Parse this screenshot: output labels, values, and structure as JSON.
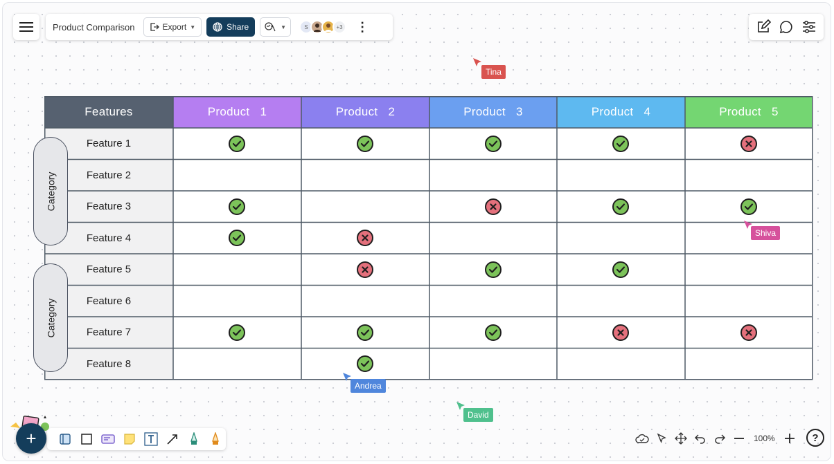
{
  "app": {
    "doc_title": "Product Comparison",
    "export_label": "Export",
    "share_label": "Share",
    "avatars": [
      {
        "initial": "S",
        "bg": "#e3e8f5"
      },
      {
        "initial": "",
        "bg": "#c9a88d"
      },
      {
        "initial": "",
        "bg": "#e6b34a"
      },
      {
        "initial": "+3",
        "bg": "#eef0f3"
      }
    ],
    "zoom_label": "100%",
    "help_label": "?"
  },
  "table": {
    "header_features": "Features",
    "products": [
      {
        "label": "Product   1",
        "color": "#b57ef1"
      },
      {
        "label": "Product   2",
        "color": "#8b80ef"
      },
      {
        "label": "Product   3",
        "color": "#6b9ff0"
      },
      {
        "label": "Product   4",
        "color": "#5eb9f0"
      },
      {
        "label": "Product   5",
        "color": "#74d672"
      }
    ],
    "features_header_color": "#566170",
    "grid_color": "#4f5a66",
    "features": [
      "Feature 1",
      "Feature 2",
      "Feature 3",
      "Feature 4",
      "Feature 5",
      "Feature 6",
      "Feature 7",
      "Feature 8"
    ],
    "categories": [
      {
        "label": "Category",
        "rows": [
          1,
          4
        ]
      },
      {
        "label": "Category",
        "rows": [
          5,
          8
        ]
      }
    ],
    "marks": [
      [
        "check",
        "check",
        "check",
        "check",
        "cross"
      ],
      [
        "",
        "",
        "",
        "",
        ""
      ],
      [
        "check",
        "",
        "cross",
        "check",
        "check"
      ],
      [
        "check",
        "cross",
        "",
        "",
        ""
      ],
      [
        "",
        "cross",
        "check",
        "check",
        ""
      ],
      [
        "",
        "",
        "",
        "",
        ""
      ],
      [
        "check",
        "check",
        "check",
        "cross",
        "cross"
      ],
      [
        "",
        "check",
        "",
        "",
        ""
      ]
    ]
  },
  "cursors": [
    {
      "name": "Tina",
      "color": "#d9534f"
    },
    {
      "name": "Shiva",
      "color": "#d6519c"
    },
    {
      "name": "Andrea",
      "color": "#4f86dc"
    },
    {
      "name": "David",
      "color": "#4fc08d"
    }
  ]
}
